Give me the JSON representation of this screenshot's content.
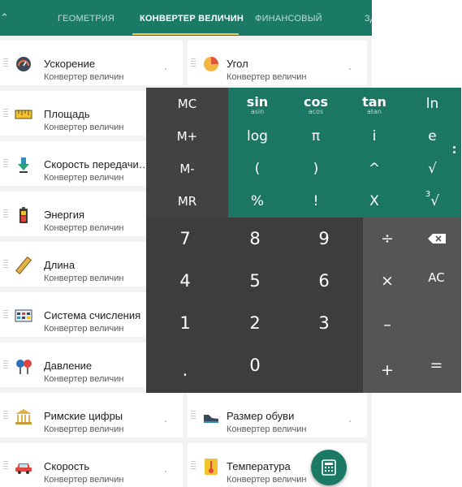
{
  "tabs": [
    {
      "label": "ГЕОМЕТРИЯ",
      "active": false
    },
    {
      "label": "КОНВЕРТЕР ВЕЛИЧИН",
      "active": true
    },
    {
      "label": "ФИНАНСОВЫЙ",
      "active": false
    },
    {
      "label": "ЗД",
      "active": false
    }
  ],
  "colors": {
    "primary": "#1a7a66",
    "tab_indicator": "#f2c94c",
    "sci_panel": "#1b7664",
    "mem_panel": "#424242",
    "num_panel": "#3d3d3d",
    "op_panel": "#555555"
  },
  "converters": [
    {
      "title": "Ускорение",
      "subtitle": "Конвертер величин",
      "icon": "speedometer-icon"
    },
    {
      "title": "Угол",
      "subtitle": "Конвертер величин",
      "icon": "angle-pie-icon"
    },
    {
      "title": "Площадь",
      "subtitle": "Конвертер величин",
      "icon": "area-ruler-icon"
    },
    {
      "title": "Скорость передачи…",
      "subtitle": "Конвертер величин",
      "icon": "data-transfer-icon"
    },
    {
      "title": "Энергия",
      "subtitle": "Конвертер величин",
      "icon": "battery-icon"
    },
    {
      "title": "Длина",
      "subtitle": "Конвертер величин",
      "icon": "ruler-icon"
    },
    {
      "title": "Система счисления",
      "subtitle": "Конвертер величин",
      "icon": "numeral-system-icon"
    },
    {
      "title": "Давление",
      "subtitle": "Конвертер величин",
      "icon": "pressure-gauge-icon"
    },
    {
      "title": "Римские цифры",
      "subtitle": "Конвертер величин",
      "icon": "roman-building-icon"
    },
    {
      "title": "Размер обуви",
      "subtitle": "Конвертер величин",
      "icon": "shoe-icon"
    },
    {
      "title": "Скорость",
      "subtitle": "Конвертер величин",
      "icon": "car-icon"
    },
    {
      "title": "Температура",
      "subtitle": "Конвертер величин",
      "icon": "thermometer-icon"
    }
  ],
  "calculator": {
    "memory": [
      "MC",
      "M+",
      "M-",
      "MR"
    ],
    "scientific": {
      "sin": {
        "main": "sin",
        "inverse": "asin"
      },
      "cos": {
        "main": "cos",
        "inverse": "acos"
      },
      "tan": {
        "main": "tan",
        "inverse": "atan"
      },
      "keys": [
        "ln",
        "log",
        "π",
        "i",
        "e",
        "(",
        ")",
        "^",
        "√",
        "%",
        "!",
        "X",
        "∛"
      ],
      "cube_root_index": "3"
    },
    "digits": [
      "7",
      "8",
      "9",
      "4",
      "5",
      "6",
      "1",
      "2",
      "3",
      ".",
      "0"
    ],
    "ops": {
      "divide": "÷",
      "multiply": "×",
      "minus": "–",
      "plus": "+",
      "equals": "=",
      "clear": "AC",
      "backspace": "backspace-icon"
    }
  },
  "fab_icon": "calculator-icon"
}
